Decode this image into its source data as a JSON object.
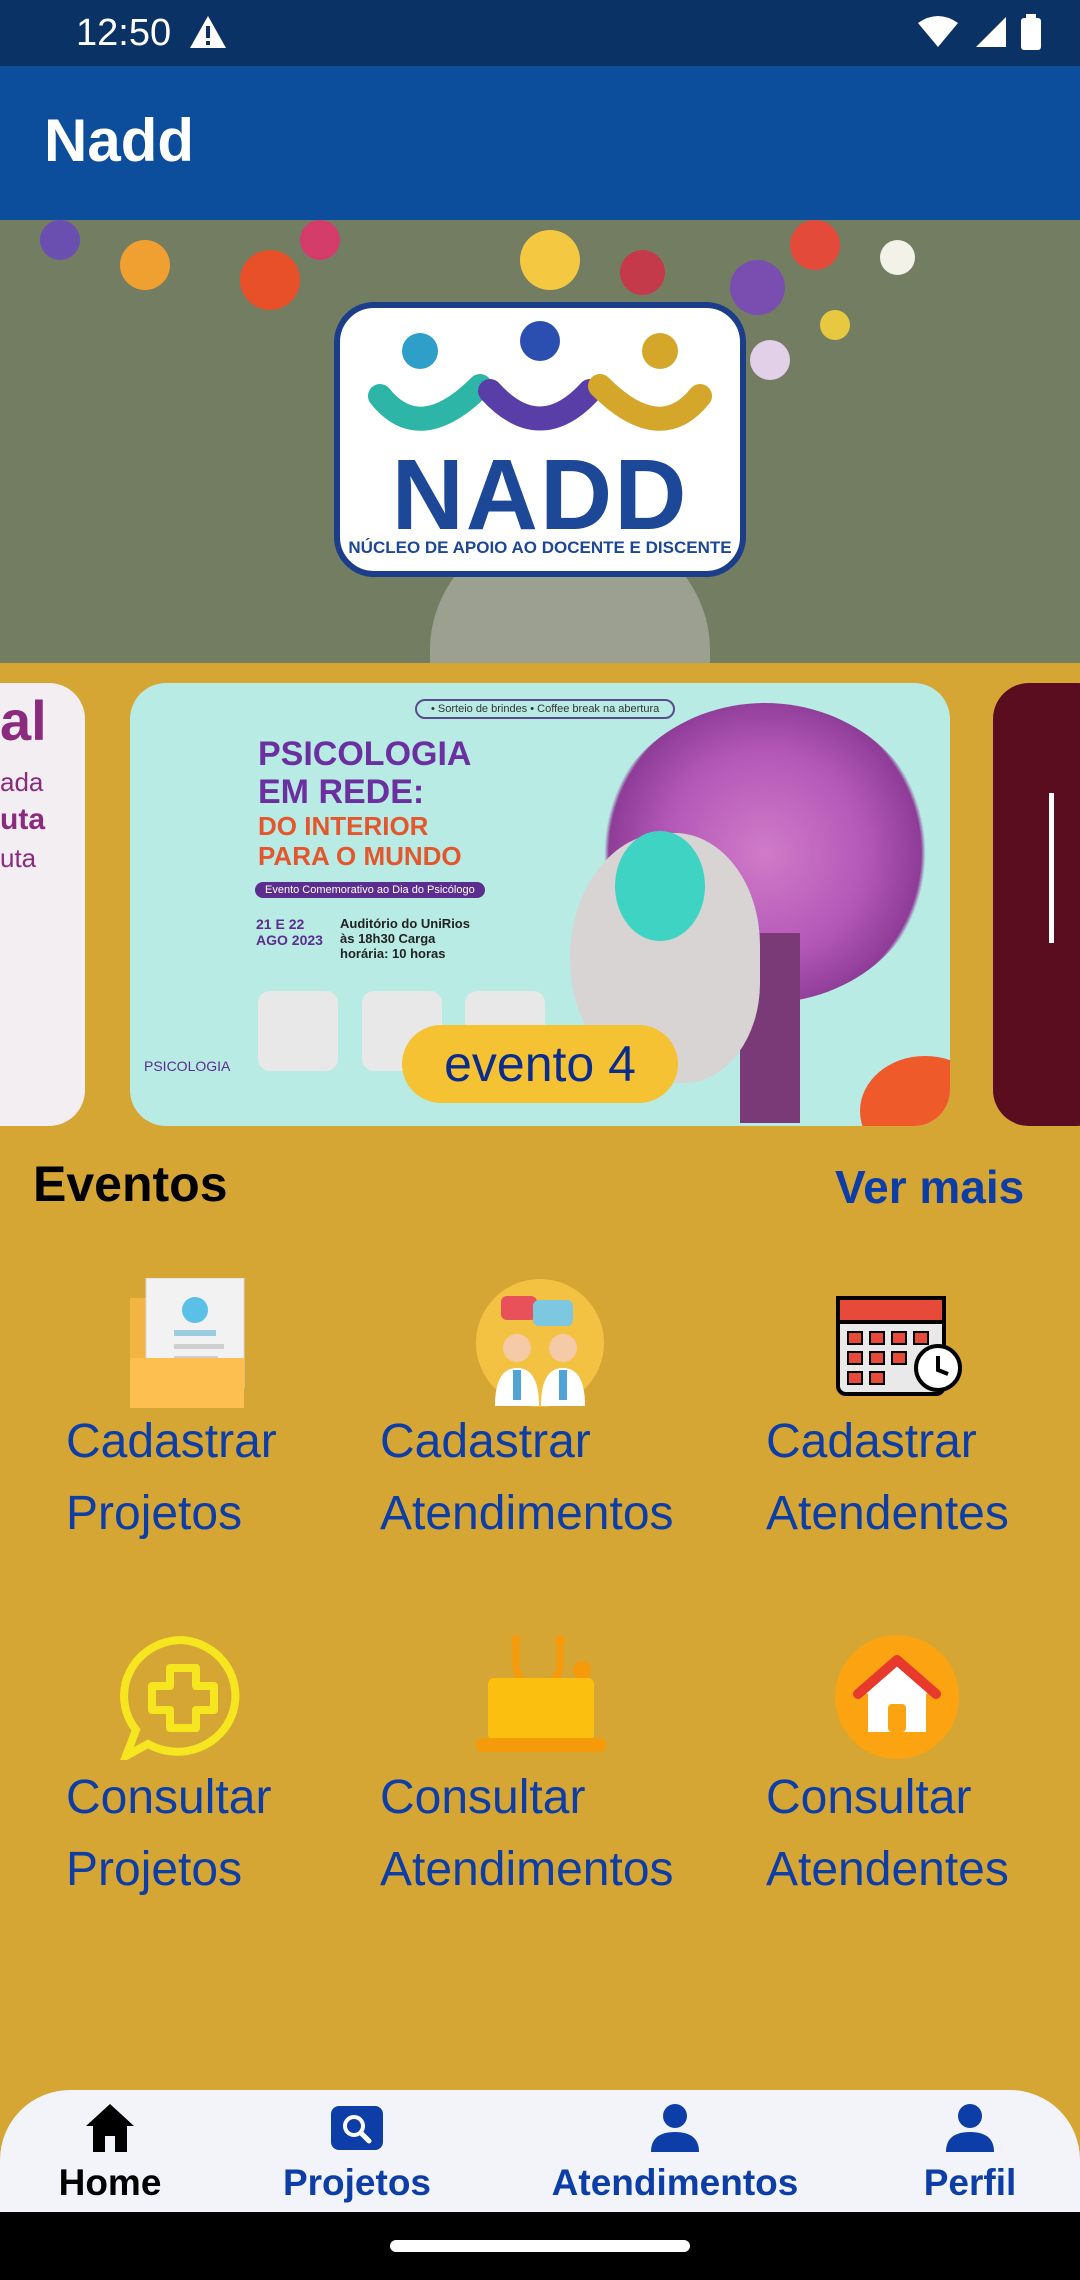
{
  "status_bar": {
    "time": "12:50"
  },
  "app_bar": {
    "title": "Nadd"
  },
  "hero": {
    "logo_text": "NADD",
    "logo_subtitle": "NÚCLEO DE APOIO AO DOCENTE E DISCENTE"
  },
  "carousel": {
    "left_card": {
      "title": "al",
      "lines": [
        "ada",
        "uta",
        "uta"
      ]
    },
    "center_card": {
      "top_note": "• Sorteio de brindes • Coffee break na abertura",
      "title_line1": "PSICOLOGIA",
      "title_line2": "EM REDE:",
      "subtitle_line1": "DO INTERIOR",
      "subtitle_line2": "PARA O MUNDO",
      "pill": "Evento Comemorativo ao Dia do Psicólogo",
      "date": "21 E 22 AGO 2023",
      "info": "Auditório do UniRios às 18h30 Carga horária: 10 horas",
      "brand": "PSICOLOGIA"
    },
    "caption": "evento 4"
  },
  "events_section": {
    "title": "Eventos",
    "see_more": "Ver mais"
  },
  "tiles": [
    {
      "line1": "Cadastrar",
      "line2": "Projetos",
      "icon": "register-document-icon"
    },
    {
      "line1": "Cadastrar",
      "line2": "Atendimentos",
      "icon": "doctors-chat-icon"
    },
    {
      "line1": "Cadastrar",
      "line2": "Atendentes",
      "icon": "calendar-clock-icon"
    },
    {
      "line1": "Consultar",
      "line2": "Projetos",
      "icon": "plus-chat-icon"
    },
    {
      "line1": "Consultar",
      "line2": "Atendimentos",
      "icon": "stethoscope-laptop-icon"
    },
    {
      "line1": "Consultar",
      "line2": "Atendentes",
      "icon": "home-circle-icon"
    }
  ],
  "bottom_nav": [
    {
      "label": "Home",
      "icon": "home-icon",
      "active": true
    },
    {
      "label": "Projetos",
      "icon": "search-box-icon"
    },
    {
      "label": "Atendimentos",
      "icon": "person-icon"
    },
    {
      "label": "Perfil",
      "icon": "person-icon"
    }
  ],
  "colors": {
    "background": "#D6A634",
    "app_bar": "#0C4E9C",
    "status_bar": "#0B3264",
    "link_blue": "#0D3DA6",
    "caption_pill": "#F4C233"
  }
}
